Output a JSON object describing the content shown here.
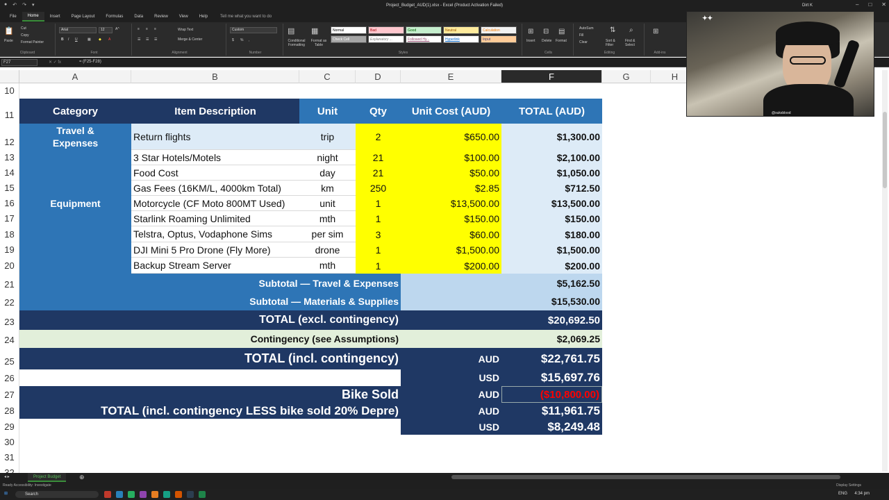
{
  "window": {
    "title": "Project_Budget_AUD(1).xlsx  -  Excel (Product Activation Failed)",
    "user": "Dirt K"
  },
  "ribbon_tabs": [
    "File",
    "Home",
    "Insert",
    "Page Layout",
    "Formulas",
    "Data",
    "Review",
    "View",
    "Help"
  ],
  "tell_me": "Tell me what you want to do",
  "ribbon": {
    "clipboard": {
      "paste": "Paste",
      "cut": "Cut",
      "copy": "Copy",
      "format_painter": "Format Painter",
      "label": "Clipboard"
    },
    "font": {
      "name": "Arial",
      "size": "12",
      "label": "Font"
    },
    "alignment": {
      "wrap": "Wrap Text",
      "merge": "Merge & Center",
      "label": "Alignment"
    },
    "number": {
      "format": "Custom",
      "label": "Number"
    },
    "styles": {
      "conditional": "Conditional Formatting",
      "format_table": "Format as Table",
      "cells": [
        "Normal",
        "Bad",
        "Good",
        "Neutral",
        "Calculation",
        "Check Cell",
        "Explanatory ...",
        "Followed Hy...",
        "Hyperlink",
        "Input"
      ],
      "label": "Styles"
    },
    "cells_group": {
      "insert": "Insert",
      "delete": "Delete",
      "format": "Format",
      "label": "Cells"
    },
    "editing": {
      "autosum": "AutoSum",
      "fill": "Fill",
      "clear": "Clear",
      "sort": "Sort & Filter",
      "find": "Find & Select",
      "label": "Editing"
    },
    "addins": {
      "label": "Add-ins"
    }
  },
  "formula_bar": {
    "name_box": "F27",
    "formula": "= (F25-F28)"
  },
  "columns": [
    "A",
    "B",
    "C",
    "D",
    "E",
    "F",
    "G",
    "H"
  ],
  "rows": [
    "10",
    "11",
    "12",
    "13",
    "14",
    "15",
    "16",
    "17",
    "18",
    "19",
    "20",
    "21",
    "22",
    "23",
    "24",
    "25",
    "26",
    "27",
    "28",
    "29",
    "30",
    "31",
    "32"
  ],
  "table": {
    "headers": {
      "category": "Category",
      "item": "Item Description",
      "unit": "Unit",
      "qty": "Qty",
      "unit_cost": "Unit Cost (AUD)",
      "total": "TOTAL (AUD)"
    },
    "cat_travel": "Travel & Expenses",
    "cat_equipment": "Equipment",
    "items": [
      {
        "item": "Return flights",
        "unit": "trip",
        "qty": "2",
        "unit_cost": "$650.00",
        "total": "$1,300.00"
      },
      {
        "item": "3 Star Hotels/Motels",
        "unit": "night",
        "qty": "21",
        "unit_cost": "$100.00",
        "total": "$2,100.00"
      },
      {
        "item": "Food Cost",
        "unit": "day",
        "qty": "21",
        "unit_cost": "$50.00",
        "total": "$1,050.00"
      },
      {
        "item": "Gas Fees (16KM/L, 4000km Total)",
        "unit": "km",
        "qty": "250",
        "unit_cost": "$2.85",
        "total": "$712.50"
      },
      {
        "item": "Motorcycle (CF Moto 800MT Used)",
        "unit": "unit",
        "qty": "1",
        "unit_cost": "$13,500.00",
        "total": "$13,500.00"
      },
      {
        "item": "Starlink Roaming Unlimited",
        "unit": "mth",
        "qty": "1",
        "unit_cost": "$150.00",
        "total": "$150.00"
      },
      {
        "item": "Telstra, Optus, Vodaphone Sims",
        "unit": "per sim",
        "qty": "3",
        "unit_cost": "$60.00",
        "total": "$180.00"
      },
      {
        "item": "DJI Mini 5 Pro Drone (Fly More)",
        "unit": "drone",
        "qty": "1",
        "unit_cost": "$1,500.00",
        "total": "$1,500.00"
      },
      {
        "item": "Backup Stream Server",
        "unit": "mth",
        "qty": "1",
        "unit_cost": "$200.00",
        "total": "$200.00"
      }
    ],
    "subtotal_travel": {
      "label": "Subtotal — Travel & Expenses",
      "value": "$5,162.50"
    },
    "subtotal_materials": {
      "label": "Subtotal — Materials & Supplies",
      "value": "$15,530.00"
    },
    "total_excl": {
      "label": "TOTAL (excl. contingency)",
      "value": "$20,692.50"
    },
    "contingency": {
      "label": "Contingency (see Assumptions)",
      "value": "$2,069.25"
    },
    "total_incl": {
      "label": "TOTAL (incl. contingency)",
      "currency": "AUD",
      "value": "$22,761.75"
    },
    "total_incl_usd": {
      "currency": "USD",
      "value": "$15,697.76"
    },
    "bike_sold": {
      "label": "Bike Sold",
      "currency": "AUD",
      "value": "($10,800.00)"
    },
    "total_less": {
      "label": "TOTAL (incl. contingency LESS bike sold 20% Depre)",
      "currency": "AUD",
      "value": "$11,961.75"
    },
    "total_less_usd": {
      "currency": "USD",
      "value": "$8,249.48"
    }
  },
  "webcam": {
    "handle": "@suksblood"
  },
  "sheet_tab": "Project Budget",
  "status": {
    "left": "Ready    Accessibility: Investigate",
    "right": "Display Settings"
  },
  "taskbar": {
    "search": "Search",
    "lang": "ENG",
    "time": "4:34 pm"
  },
  "colors": {
    "navy": "#1f3864",
    "mid_blue": "#2e75b6",
    "light_blue": "#ddebf7",
    "yellow": "#ffff00",
    "green": "#e2efda",
    "negative": "#ff0000"
  }
}
